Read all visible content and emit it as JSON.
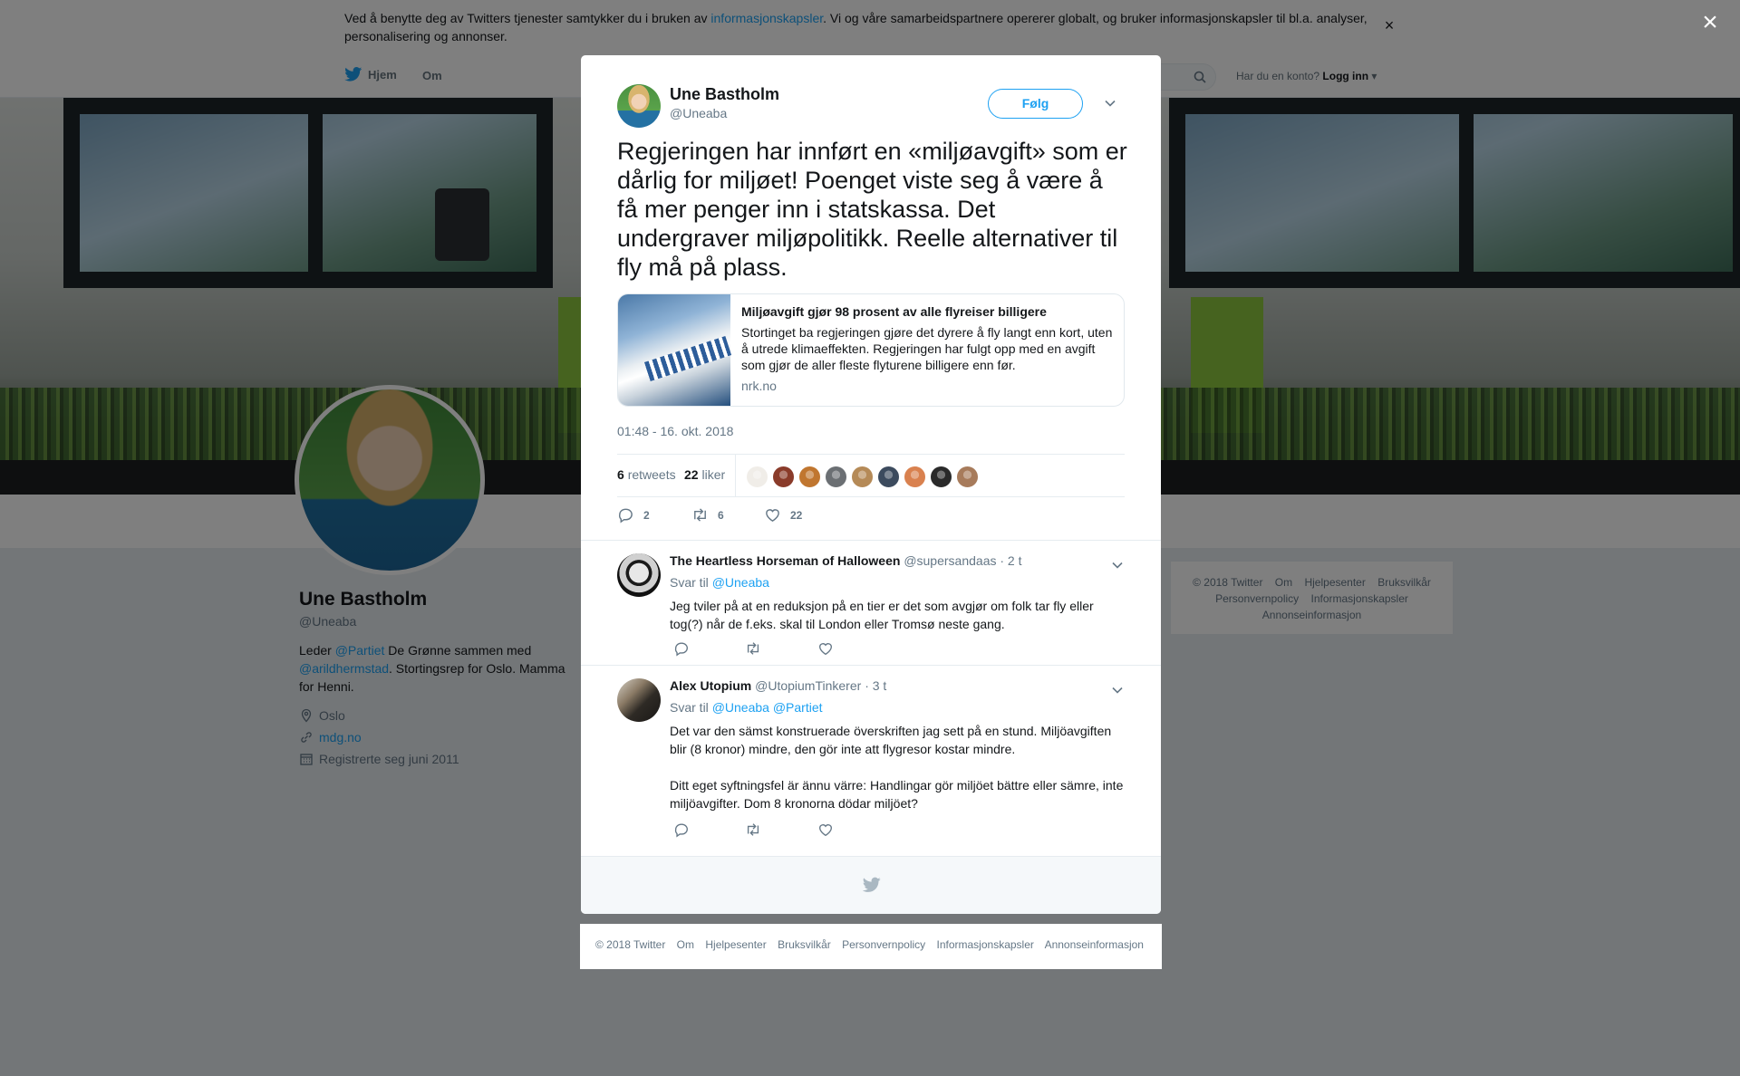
{
  "cookie": {
    "text_before": "Ved å benytte deg av Twitters tjenester samtykker du i bruken av ",
    "link": "informasjonskapsler",
    "text_after": ". Vi og våre samarbeidspartnere opererer globalt, og bruker informasjonskapsler til bl.a. analyser, personalisering og annonser.",
    "close": "×"
  },
  "nav": {
    "home": "Hjem",
    "about": "Om",
    "login_prompt": "Har du en konto?",
    "login": "Logg inn"
  },
  "profile": {
    "name": "Une Bastholm",
    "handle": "@Uneaba",
    "bio_1": "Leder ",
    "bio_link1": "@Partiet",
    "bio_2": " De Grønne sammen med ",
    "bio_link2": "@arildhermstad",
    "bio_3": ". Stortingsrep for Oslo. Mamma for Henni.",
    "location": "Oslo",
    "website": "mdg.no",
    "joined": "Registrerte seg juni 2011"
  },
  "side_footer": {
    "items": [
      "© 2018 Twitter",
      "Om",
      "Hjelpesenter",
      "Bruksvilkår",
      "Personvernpolicy",
      "Informasjonskapsler",
      "Annonseinformasjon"
    ]
  },
  "modal_close": "×",
  "tweet": {
    "name": "Une Bastholm",
    "handle": "@Uneaba",
    "follow": "Følg",
    "text": "Regjeringen har innført en «miljøavgift» som er dårlig for miljøet! Poenget viste seg å være å få mer penger inn i statskassa. Det undergraver miljøpolitikk. Reelle alternativer til fly må på plass.",
    "card": {
      "title": "Miljøavgift gjør 98 prosent av alle flyreiser billigere",
      "description": "Stortinget ba regjeringen gjøre det dyrere å fly langt enn kort, uten å utrede klimaeffekten. Regjeringen har fulgt opp med en avgift som gjør de aller fleste flyturene billigere enn før.",
      "domain": "nrk.no"
    },
    "time": "01:48 - 16. okt. 2018",
    "retweets_count": "6",
    "retweets_label": "retweets",
    "likes_count": "22",
    "likes_label": "liker",
    "liker_colors": [
      "#f0ede8",
      "#8a3b2a",
      "#c0762f",
      "#6b6f73",
      "#b58a57",
      "#3c4b5e",
      "#d9814f",
      "#2a2a2a",
      "#a77b5b"
    ],
    "actions": {
      "replies": "2",
      "retweets": "6",
      "likes": "22"
    },
    "colors": {
      "accent": "#1da1f2",
      "text": "#14171a",
      "muted": "#657786"
    }
  },
  "replies": [
    {
      "name": "The Heartless Horseman of Halloween",
      "handle": "@supersandaas",
      "time": "· 2 t",
      "reply_to_label": "Svar til",
      "reply_to": "@Uneaba",
      "text": "Jeg tviler på at en reduksjon på en tier er det som avgjør om folk tar fly eller tog(?) når de f.eks. skal til London eller Tromsø neste gang."
    },
    {
      "name": "Alex Utopium",
      "handle": "@UtopiumTinkerer",
      "time": "· 3 t",
      "reply_to_label": "Svar til",
      "reply_to": "@Uneaba @Partiet",
      "text_1": "Det var den sämst konstruerade överskriften jag sett på en stund. Miljöavgiften blir (8 kronor) mindre, den gör inte att flygresor kostar mindre.",
      "text_2": "Ditt eget syftningsfel är ännu värre: Handlingar gör miljöet bättre eller sämre, inte miljöavgifter. Dom 8 kronorna dödar miljöet?"
    }
  ],
  "bottom_footer": {
    "items": [
      "© 2018 Twitter",
      "Om",
      "Hjelpesenter",
      "Bruksvilkår",
      "Personvernpolicy",
      "Informasjonskapsler",
      "Annonseinformasjon"
    ]
  }
}
